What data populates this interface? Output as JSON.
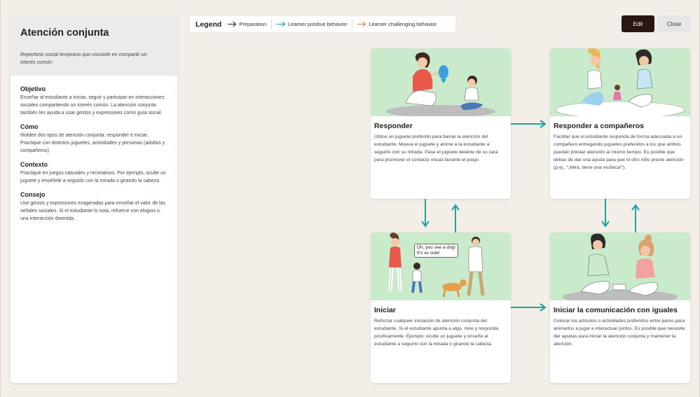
{
  "sidebar": {
    "title": "Atención conjunta",
    "subtitle": "Repertorio social temprano que consiste en compartir un interés común",
    "sections": [
      {
        "heading": "Objetivo",
        "text": "Enseñar al estudiante a iniciar, seguir y participar en interacciones sociales compartiendo un interés común. La atención conjunta también les ayuda a usar gestos y expresiones como guía social."
      },
      {
        "heading": "Cómo",
        "text": "Moldee dos tipos de atención conjunta: responder e iniciar. Practique con distintos juguetes, actividades y personas (adultos y compañeros)."
      },
      {
        "heading": "Contexto",
        "text": "Practique en juegos naturales y recreativos. Por ejemplo, oculte un juguete y enséñele a seguirlo con la mirada o girando la cabeza."
      },
      {
        "heading": "Consejo",
        "text": "Use gestos y expresiones exageradas para enseñar el valor de las señales sociales. Si el estudiante lo nota, refuerce con elogios o una interacción divertida."
      }
    ]
  },
  "legend": {
    "title": "Legend",
    "items": [
      "Preparation",
      "Learner positive behavior",
      "Learner challenging behavior"
    ],
    "colors": {
      "preparation": "#222222",
      "positive": "#1aa3a3",
      "challenging": "#e07a4f"
    }
  },
  "buttons": {
    "edit": "Edit",
    "close": "Close"
  },
  "cards": [
    {
      "title": "Responder",
      "text": "Utilice un juguete preferido para llamar la atención del estudiante. Mueva el juguete y anime a la estudiante a seguirlo con su mirada. Pase el juguete delante de su cara para promover el contacto visual durante el juego."
    },
    {
      "title": "Responder a compañeros",
      "text": "Facilitar que el estudiante responda de forma adecuada a un compañero entregando juguetes preferidos a los que ambos puedan prestar atención al mismo tiempo. Es posible que debas de dar una ayuda para que el otro niño preste atención (p.ej., \"¡Mira, tiene una muñeca!\")."
    },
    {
      "title": "Iniciar",
      "text": "Reforzar cualquier iniciación de atención conjunta del estudiante. Si el estudiante apunta a algo, mire y responda positivamente. Ejemplo: oculte un juguete y enseñe al estudiante a seguirlo con la mirada o girando la cabeza."
    },
    {
      "title": "Iniciar la comunicación con iguales",
      "text": "Colocar los artículos o actividades preferidos entre pares para animarlos a jugar e interactuar juntos. Es posible que necesite dar ayudas para iniciar la atención conjunta y mantener la atención."
    }
  ],
  "speech_bubble": {
    "line1": "Oh, you see a dog!",
    "line2": "It's so cute!"
  },
  "colors": {
    "accent": "#1aa3a3",
    "card_image_bg": "#c9ebcb",
    "edit_button": "#2a1512"
  }
}
